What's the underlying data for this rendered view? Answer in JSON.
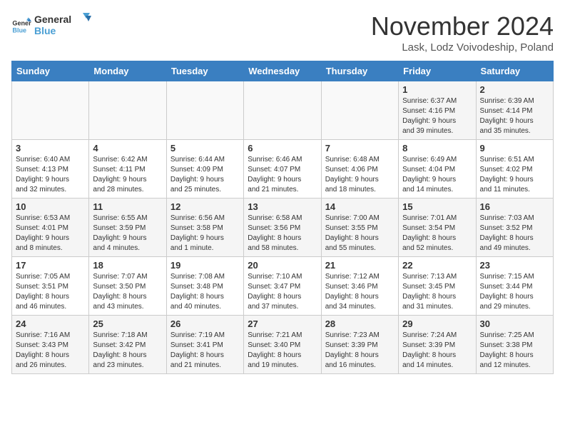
{
  "header": {
    "logo_line1": "General",
    "logo_line2": "Blue",
    "month_year": "November 2024",
    "location": "Lask, Lodz Voivodeship, Poland"
  },
  "weekdays": [
    "Sunday",
    "Monday",
    "Tuesday",
    "Wednesday",
    "Thursday",
    "Friday",
    "Saturday"
  ],
  "weeks": [
    [
      {
        "day": "",
        "info": ""
      },
      {
        "day": "",
        "info": ""
      },
      {
        "day": "",
        "info": ""
      },
      {
        "day": "",
        "info": ""
      },
      {
        "day": "",
        "info": ""
      },
      {
        "day": "1",
        "info": "Sunrise: 6:37 AM\nSunset: 4:16 PM\nDaylight: 9 hours\nand 39 minutes."
      },
      {
        "day": "2",
        "info": "Sunrise: 6:39 AM\nSunset: 4:14 PM\nDaylight: 9 hours\nand 35 minutes."
      }
    ],
    [
      {
        "day": "3",
        "info": "Sunrise: 6:40 AM\nSunset: 4:13 PM\nDaylight: 9 hours\nand 32 minutes."
      },
      {
        "day": "4",
        "info": "Sunrise: 6:42 AM\nSunset: 4:11 PM\nDaylight: 9 hours\nand 28 minutes."
      },
      {
        "day": "5",
        "info": "Sunrise: 6:44 AM\nSunset: 4:09 PM\nDaylight: 9 hours\nand 25 minutes."
      },
      {
        "day": "6",
        "info": "Sunrise: 6:46 AM\nSunset: 4:07 PM\nDaylight: 9 hours\nand 21 minutes."
      },
      {
        "day": "7",
        "info": "Sunrise: 6:48 AM\nSunset: 4:06 PM\nDaylight: 9 hours\nand 18 minutes."
      },
      {
        "day": "8",
        "info": "Sunrise: 6:49 AM\nSunset: 4:04 PM\nDaylight: 9 hours\nand 14 minutes."
      },
      {
        "day": "9",
        "info": "Sunrise: 6:51 AM\nSunset: 4:02 PM\nDaylight: 9 hours\nand 11 minutes."
      }
    ],
    [
      {
        "day": "10",
        "info": "Sunrise: 6:53 AM\nSunset: 4:01 PM\nDaylight: 9 hours\nand 8 minutes."
      },
      {
        "day": "11",
        "info": "Sunrise: 6:55 AM\nSunset: 3:59 PM\nDaylight: 9 hours\nand 4 minutes."
      },
      {
        "day": "12",
        "info": "Sunrise: 6:56 AM\nSunset: 3:58 PM\nDaylight: 9 hours\nand 1 minute."
      },
      {
        "day": "13",
        "info": "Sunrise: 6:58 AM\nSunset: 3:56 PM\nDaylight: 8 hours\nand 58 minutes."
      },
      {
        "day": "14",
        "info": "Sunrise: 7:00 AM\nSunset: 3:55 PM\nDaylight: 8 hours\nand 55 minutes."
      },
      {
        "day": "15",
        "info": "Sunrise: 7:01 AM\nSunset: 3:54 PM\nDaylight: 8 hours\nand 52 minutes."
      },
      {
        "day": "16",
        "info": "Sunrise: 7:03 AM\nSunset: 3:52 PM\nDaylight: 8 hours\nand 49 minutes."
      }
    ],
    [
      {
        "day": "17",
        "info": "Sunrise: 7:05 AM\nSunset: 3:51 PM\nDaylight: 8 hours\nand 46 minutes."
      },
      {
        "day": "18",
        "info": "Sunrise: 7:07 AM\nSunset: 3:50 PM\nDaylight: 8 hours\nand 43 minutes."
      },
      {
        "day": "19",
        "info": "Sunrise: 7:08 AM\nSunset: 3:48 PM\nDaylight: 8 hours\nand 40 minutes."
      },
      {
        "day": "20",
        "info": "Sunrise: 7:10 AM\nSunset: 3:47 PM\nDaylight: 8 hours\nand 37 minutes."
      },
      {
        "day": "21",
        "info": "Sunrise: 7:12 AM\nSunset: 3:46 PM\nDaylight: 8 hours\nand 34 minutes."
      },
      {
        "day": "22",
        "info": "Sunrise: 7:13 AM\nSunset: 3:45 PM\nDaylight: 8 hours\nand 31 minutes."
      },
      {
        "day": "23",
        "info": "Sunrise: 7:15 AM\nSunset: 3:44 PM\nDaylight: 8 hours\nand 29 minutes."
      }
    ],
    [
      {
        "day": "24",
        "info": "Sunrise: 7:16 AM\nSunset: 3:43 PM\nDaylight: 8 hours\nand 26 minutes."
      },
      {
        "day": "25",
        "info": "Sunrise: 7:18 AM\nSunset: 3:42 PM\nDaylight: 8 hours\nand 23 minutes."
      },
      {
        "day": "26",
        "info": "Sunrise: 7:19 AM\nSunset: 3:41 PM\nDaylight: 8 hours\nand 21 minutes."
      },
      {
        "day": "27",
        "info": "Sunrise: 7:21 AM\nSunset: 3:40 PM\nDaylight: 8 hours\nand 19 minutes."
      },
      {
        "day": "28",
        "info": "Sunrise: 7:23 AM\nSunset: 3:39 PM\nDaylight: 8 hours\nand 16 minutes."
      },
      {
        "day": "29",
        "info": "Sunrise: 7:24 AM\nSunset: 3:39 PM\nDaylight: 8 hours\nand 14 minutes."
      },
      {
        "day": "30",
        "info": "Sunrise: 7:25 AM\nSunset: 3:38 PM\nDaylight: 8 hours\nand 12 minutes."
      }
    ]
  ]
}
